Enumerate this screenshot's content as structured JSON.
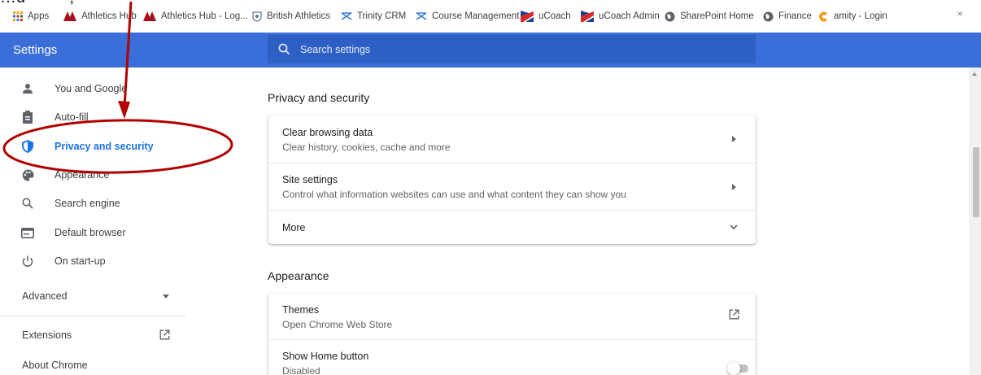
{
  "bookmarks_bar": {
    "items": [
      {
        "label": "Apps",
        "icon": "apps-grid-icon"
      },
      {
        "label": "Athletics Hub",
        "icon": "athletics-hub-logo-icon"
      },
      {
        "label": "Athletics Hub - Log...",
        "icon": "athletics-hub-logo-icon"
      },
      {
        "label": "British Athletics",
        "icon": "british-athletics-crest-icon"
      },
      {
        "label": "Trinity CRM",
        "icon": "trinity-crm-icon"
      },
      {
        "label": "Course Management",
        "icon": "trinity-crm-icon"
      },
      {
        "label": "uCoach",
        "icon": "ucoach-flag-icon"
      },
      {
        "label": "uCoach Admin",
        "icon": "ucoach-flag-icon"
      },
      {
        "label": "SharePoint Home",
        "icon": "globe-icon"
      },
      {
        "label": "Finance",
        "icon": "globe-icon"
      },
      {
        "label": "amity - Login",
        "icon": "amity-logo-icon"
      }
    ],
    "overflow": "»"
  },
  "header": {
    "title": "Settings",
    "search_placeholder": "Search settings"
  },
  "sidebar": {
    "items": [
      {
        "label": "You and Google",
        "icon": "person-icon"
      },
      {
        "label": "Auto-fill",
        "icon": "clipboard-icon"
      },
      {
        "label": "Privacy and security",
        "icon": "shield-icon",
        "active": true
      },
      {
        "label": "Appearance",
        "icon": "palette-icon"
      },
      {
        "label": "Search engine",
        "icon": "search-icon"
      },
      {
        "label": "Default browser",
        "icon": "browser-window-icon"
      },
      {
        "label": "On start-up",
        "icon": "power-icon"
      }
    ],
    "advanced": "Advanced",
    "extensions": "Extensions",
    "about": "About Chrome"
  },
  "main": {
    "privacy": {
      "title": "Privacy and security",
      "rows": [
        {
          "title": "Clear browsing data",
          "subtitle": "Clear history, cookies, cache and more"
        },
        {
          "title": "Site settings",
          "subtitle": "Control what information websites can use and what content they can show you"
        },
        {
          "title": "More"
        }
      ]
    },
    "appearance": {
      "title": "Appearance",
      "rows": [
        {
          "title": "Themes",
          "subtitle": "Open Chrome Web Store"
        },
        {
          "title": "Show Home button",
          "subtitle": "Disabled",
          "toggle": false
        }
      ]
    }
  },
  "annotation": {
    "text": "…u   ·     ·     ·                      ·  ,"
  },
  "colors": {
    "header_blue": "#3a6ed8",
    "search_blue": "#2d5fc4",
    "active_blue": "#1a73e8",
    "annotation_red": "#b20000"
  }
}
